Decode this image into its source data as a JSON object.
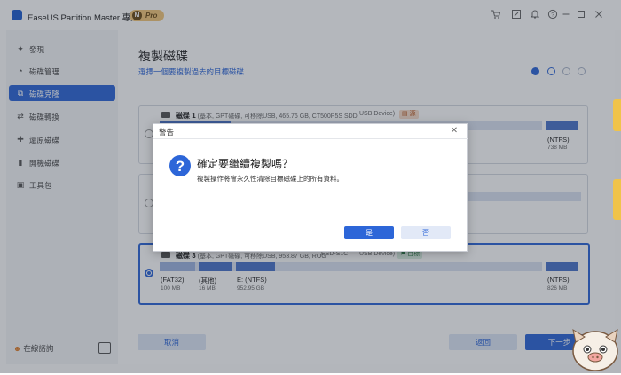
{
  "app": {
    "title": "EaseUS Partition Master 專業版",
    "badge_letter": "M",
    "badge_text": "Pro",
    "accent_color": "#2d66d8"
  },
  "titlebar_icons": [
    "cart-icon",
    "feedback-icon",
    "bell-icon",
    "help-icon",
    "minimize-icon",
    "maximize-icon",
    "close-icon"
  ],
  "sidebar": {
    "items": [
      {
        "label": "發現",
        "icon": "compass-icon"
      },
      {
        "label": "磁碟管理",
        "icon": "disk-manage-icon"
      },
      {
        "label": "磁碟克隆",
        "icon": "clone-icon",
        "active": true
      },
      {
        "label": "磁碟轉換",
        "icon": "convert-icon"
      },
      {
        "label": "還原磁碟",
        "icon": "restore-icon"
      },
      {
        "label": "開機磁碟",
        "icon": "boot-icon"
      },
      {
        "label": "工具包",
        "icon": "toolkit-icon"
      }
    ],
    "support_label": "在線諮詢"
  },
  "main": {
    "title": "複製磁碟",
    "subtitle": "選擇一個要複製過去的目標磁碟",
    "disks": [
      {
        "name": "磁碟 1",
        "info": "(基本, GPT磁碟, 可移除USB, 465.76 GB, CT500P5S SDD",
        "bus": "USB Device)",
        "tag": "源",
        "last_part": {
          "name": "(NTFS)",
          "size": "738 MB"
        }
      },
      {
        "name": "磁碟 3",
        "info": "(基本, GPT磁碟, 可移除USB, 953.87 GB, ROG",
        "model": "ESD-S1C",
        "bus": "USB Device)",
        "tag": "目標",
        "partitions": [
          {
            "name": "(FAT32)",
            "size": "100 MB"
          },
          {
            "name": "(其他)",
            "size": "16 MB"
          },
          {
            "name": "E: (NTFS)",
            "size": "952.95 GB"
          },
          {
            "name": "(NTFS)",
            "size": "826 MB"
          }
        ]
      }
    ],
    "cancel_label": "取消",
    "back_label": "返回",
    "next_label": "下一步"
  },
  "dialog": {
    "title": "警告",
    "heading": "確定要繼續複製嗎？",
    "message": "複製操作將會永久性清除目標磁碟上的所有資料。",
    "yes_label": "是",
    "no_label": "否"
  }
}
